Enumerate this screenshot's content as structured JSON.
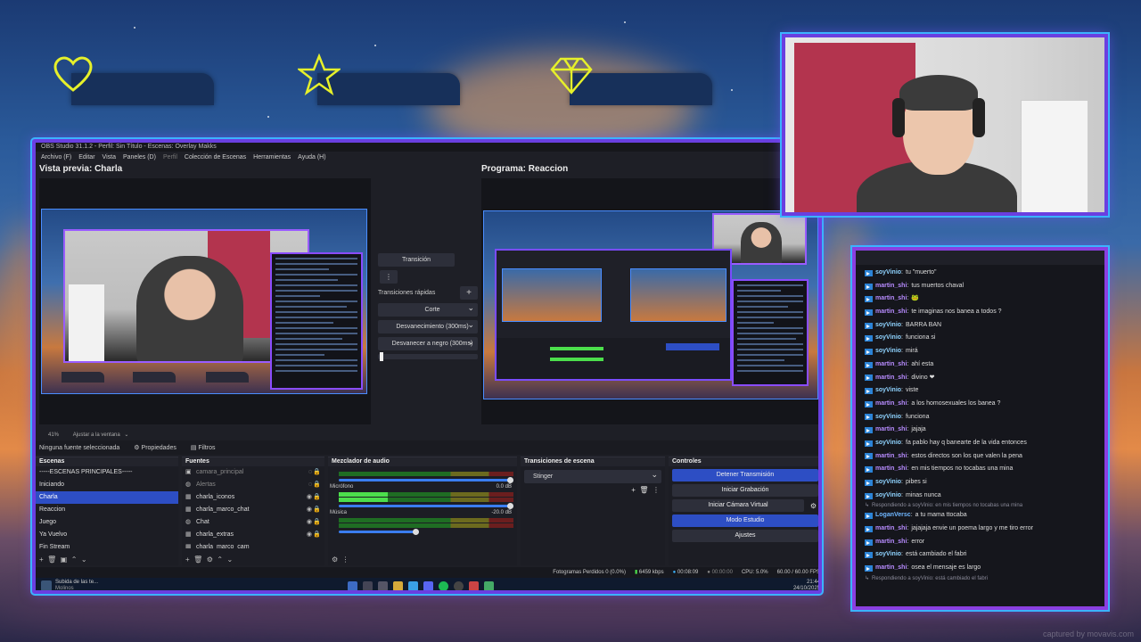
{
  "colors": {
    "frame_purple": "#6a3fe0",
    "frame_cyan": "#3bb3ff",
    "obs_blue": "#2d4ec4",
    "chat_user_blue": "#8fd3ff",
    "chat_user_purple": "#b88cff"
  },
  "overlay_badges": [
    {
      "icon": "heart-icon"
    },
    {
      "icon": "star-icon"
    },
    {
      "icon": "diamond-icon"
    }
  ],
  "obs": {
    "window_title": "OBS Studio 31.1.2 - Perfil: Sin Título - Escenas: Overlay Makks",
    "menu": [
      "Archivo (F)",
      "Editar",
      "Vista",
      "Paneles (D)",
      "Perfil",
      "Colección de Escenas",
      "Herramientas",
      "Ayuda (H)"
    ],
    "preview_label": "Vista previa: Charla",
    "program_label": "Programa: Reaccion",
    "transition": {
      "transition_button": "Transición",
      "quick_label": "Transiciones rápidas",
      "options": [
        "Corte",
        "Desvanecimiento (300ms)",
        "Desvanecer a negro (300ms)"
      ]
    },
    "zoom_status": "41%",
    "fit_status": "Ajustar a la ventana",
    "no_source": "Ninguna fuente seleccionada",
    "properties_tab": "Propiedades",
    "filters_tab": "Filtros",
    "scenes": {
      "header": "Escenas",
      "items": [
        "-----ESCENAS PRINCIPALES-----",
        "Iniciando",
        "Charla",
        "Reaccion",
        "Juego",
        "Ya Vuelvo",
        "Fin Stream"
      ],
      "active_index": 2
    },
    "sources": {
      "header": "Fuentes",
      "items": [
        "camara_principal",
        "Alertas",
        "charla_iconos",
        "charla_marco_chat",
        "Chat",
        "charla_extras",
        "charla_marco_cam"
      ]
    },
    "mixer": {
      "header": "Mezclador de audio",
      "channels": [
        {
          "name": "Micrófono",
          "db": "0.0 dB"
        },
        {
          "name": "Música",
          "db": "-20.0 dB"
        }
      ]
    },
    "scene_transitions": {
      "header": "Transiciones de escena",
      "selected": "Stinger"
    },
    "controls": {
      "header": "Controles",
      "buttons": [
        "Detener Transmisión",
        "Iniciar Grabación",
        "Iniciar Cámara Virtual",
        "Modo Estudio",
        "Ajustes"
      ]
    },
    "statusbar": {
      "dropped": "Fotogramas Perdidos 0 (0.0%)",
      "bitrate": "6459 kbps",
      "live_time": "00:08:09",
      "rec_time": "00:00:00",
      "cpu": "CPU: 5.0%",
      "fps": "60.00 / 60.00 FPS"
    },
    "taskbar": {
      "app_title": "Subida de las te...",
      "app_sub": "Molinos",
      "time": "21:44",
      "date": "24/10/2025"
    }
  },
  "chat": {
    "messages": [
      {
        "user": "soyVinio",
        "text": "tu \"muerto\"",
        "color": "c1"
      },
      {
        "user": "martin_shi",
        "text": "tus muertos chaval",
        "color": "c2"
      },
      {
        "user": "martin_shi",
        "text": "🐸",
        "color": "c2"
      },
      {
        "user": "martin_shi",
        "text": "te imaginas nos banea a todos ?",
        "color": "c2"
      },
      {
        "user": "soyVinio",
        "text": "BARRA BAN",
        "color": "c1"
      },
      {
        "user": "soyVinio",
        "text": "funciona si",
        "color": "c1"
      },
      {
        "user": "soyVinio",
        "text": "mirá",
        "color": "c1"
      },
      {
        "user": "martin_shi",
        "text": "ahí esta",
        "color": "c2"
      },
      {
        "user": "martin_shi",
        "text": "divino ❤",
        "color": "c2"
      },
      {
        "user": "soyVinio",
        "text": "viste",
        "color": "c1"
      },
      {
        "user": "martin_shi",
        "text": "a los homosexuales los banea ?",
        "color": "c2"
      },
      {
        "user": "soyVinio",
        "text": "funciona",
        "color": "c1"
      },
      {
        "user": "martin_shi",
        "text": "jajaja",
        "color": "c2"
      },
      {
        "user": "soyVinio",
        "text": "fa pablo hay q banearte de la vida entonces",
        "color": "c1"
      },
      {
        "user": "martin_shi",
        "text": "estos directos son los que valen la pena",
        "color": "c2"
      },
      {
        "user": "martin_shi",
        "text": "en mis tiempos no tocabas una mina",
        "color": "c2"
      },
      {
        "user": "soyVinio",
        "text": "pibes si",
        "color": "c1"
      },
      {
        "user": "soyVinio",
        "text": "minas nunca",
        "color": "c1"
      },
      {
        "reply": "Respondiendo a soyVinio: en mis tiempos no tocabas una mina"
      },
      {
        "user": "LoganVersc",
        "text": "a tu mama ttocaba",
        "color": "c3"
      },
      {
        "user": "martin_shi",
        "text": "jajajaja envie un poema largo y me tiro error",
        "color": "c2"
      },
      {
        "user": "martin_shi",
        "text": "error",
        "color": "c2"
      },
      {
        "user": "soyVinio",
        "text": "está cambiado el fabri",
        "color": "c1"
      },
      {
        "user": "martin_shi",
        "text": "osea el mensaje es largo",
        "color": "c2"
      },
      {
        "reply": "Respondiendo a soyVinio: está cambiado el fabri"
      }
    ]
  },
  "watermark": "captured by movavis.com"
}
